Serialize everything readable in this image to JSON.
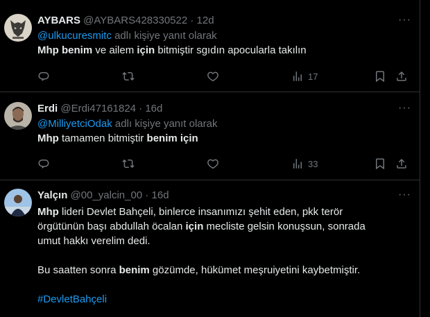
{
  "tweets": [
    {
      "name": "AYBARS",
      "handle": "@AYBARS428330522",
      "time": "12d",
      "reply_mention": "@ulkucuresmitc",
      "reply_suffix": "adlı kişiye yanıt olarak",
      "text": {
        "p1": "Mhp benim",
        "p2": " ve ailem ",
        "p3": "için",
        "p4": " bitmiştir sgıdın apocularla takılın"
      },
      "views": "17"
    },
    {
      "name": "Erdi",
      "handle": "@Erdi47161824",
      "time": "16d",
      "reply_mention": "@MilliyetciOdak",
      "reply_suffix": "adlı kişiye yanıt olarak",
      "text": {
        "p1": "Mhp",
        "p2": " tamamen bitmiştir ",
        "p3": "benim için"
      },
      "views": "33"
    },
    {
      "name": "Yalçın",
      "handle": "@00_yalcin_00",
      "time": "16d",
      "text": {
        "l1a": "Mhp",
        "l1b": " lideri Devlet Bahçeli, binlerce insanımızı şehit eden, pkk terör",
        "l2a": "örgütünün başı abdullah öcalan ",
        "l2b": "için",
        "l2c": " mecliste gelsin konuşsun, sonrada",
        "l3": "umut hakkı verelim dedi.",
        "l4a": "Bu saatten sonra ",
        "l4b": "benim",
        "l4c": " gözümde, hükümet meşruiyetini kaybetmiştir.",
        "hashtag": "#DevletBahçeli"
      }
    }
  ],
  "separator": "·",
  "more_glyph": "···",
  "icons": [
    "reply-icon",
    "retweet-icon",
    "like-icon",
    "views-icon",
    "bookmark-icon",
    "share-icon"
  ],
  "colors": {
    "background": "#000000",
    "text": "#e7e9ea",
    "muted": "#71767b",
    "link": "#1d9bf0",
    "divider": "#2f3336"
  }
}
